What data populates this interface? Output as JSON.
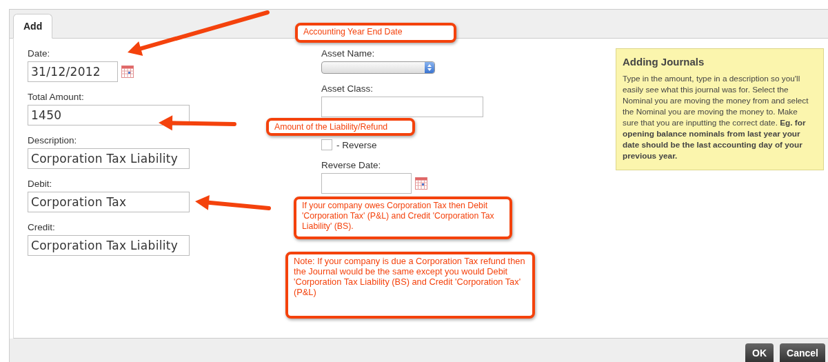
{
  "tabs": [
    {
      "label": "Add",
      "selected": true
    }
  ],
  "fields": [
    {
      "label": "Date:",
      "value": "31/12/2012",
      "kind": "date"
    },
    {
      "label": "Total Amount:",
      "value": "1450",
      "kind": "text"
    },
    {
      "label": "Description:",
      "value": "Corporation Tax Liability",
      "kind": "text"
    },
    {
      "label": "Debit:",
      "value": "Corporation Tax",
      "kind": "text"
    },
    {
      "label": "Credit:",
      "value": "Corporation Tax Liability",
      "kind": "text"
    }
  ],
  "asset_name": {
    "label": "Asset Name:"
  },
  "asset_class": {
    "label": "Asset Class:"
  },
  "reverse": {
    "label": "- Reverse",
    "checked": false
  },
  "reverse_date": {
    "label": "Reverse Date:"
  },
  "help": {
    "title": "Adding Journals",
    "body": "Type in the amount, type in a description so you'll easily see what this journal was for. Select the Nominal you are moving the money from and select the Nominal you are moving the money to. Make sure that you are inputting the correct date. **Eg. for opening balance nominals from last year your date should be the last accounting day of your previous year.**"
  },
  "buttons": [
    "OK",
    "Cancel"
  ],
  "annotations": [
    {
      "text": "Accounting Year End Date"
    },
    {
      "text": "Amount of the Liability/Refund"
    },
    {
      "text": "If your company owes Corporation Tax then Debit 'Corporation Tax' (P&L) and Credit 'Corporation Tax Liability' (BS)."
    },
    {
      "text": "Note: If your company is due a Corporation Tax refund then the Journal would be the same except you would Debit 'Corporation Tax Liability (BS) and Credit 'Corporation Tax' (P&L)"
    }
  ]
}
